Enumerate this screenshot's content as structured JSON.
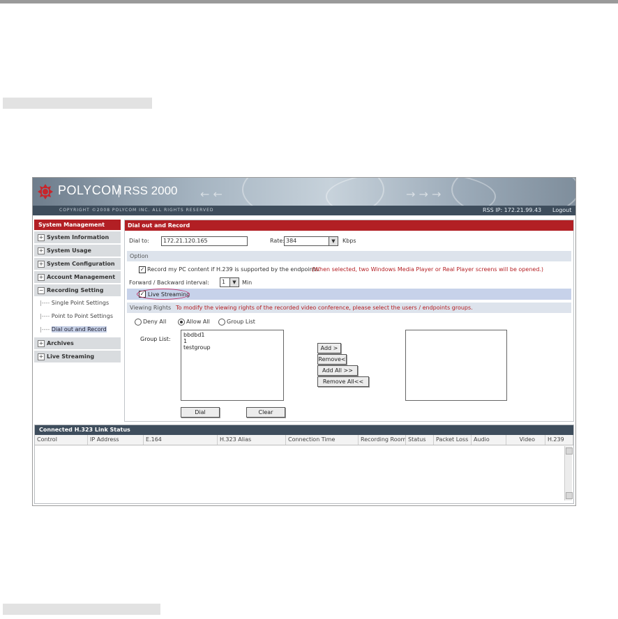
{
  "header": {
    "brand": "POLYCOM",
    "product": "RSS 2000",
    "copyright": "COPYRIGHT ©2008 POLYCOM INC. ALL RIGHTS RESERVED",
    "rss_ip": "RSS IP: 172.21.99.43",
    "logout": "Logout",
    "accent_color": "#b21f24",
    "logo_icon": "polycom-logo-icon"
  },
  "sidebar": {
    "title": "System Management",
    "items": [
      {
        "sign": "+",
        "label": "System Information"
      },
      {
        "sign": "+",
        "label": "System Usage"
      },
      {
        "sign": "+",
        "label": "System Configuration"
      },
      {
        "sign": "+",
        "label": "Account Management"
      },
      {
        "sign": "−",
        "label": "Recording Setting"
      }
    ],
    "subitems": [
      {
        "label": "Single Point Settings"
      },
      {
        "label": "Point to Point Settings"
      },
      {
        "label": "Dial out and Record"
      }
    ],
    "items_after": [
      {
        "sign": "+",
        "label": "Archives"
      },
      {
        "sign": "+",
        "label": "Live Streaming"
      }
    ]
  },
  "main": {
    "title": "Dial out and Record",
    "dial_to_label": "Dial to:",
    "dial_to_value": "172.21.120.165",
    "rate_label": "Rate:",
    "rate_value": "384",
    "rate_unit": "Kbps",
    "option_label": "Option",
    "record_pc_text": "Record my PC content if H.239 is supported by the endpoints.",
    "record_pc_note": "(When selected, two Windows Media Player or Real Player screens will be opened.)",
    "interval_label": "Forward / Backward interval:",
    "interval_value": "1",
    "interval_unit": "Min",
    "live_streaming_label": "Live Streaming",
    "viewing_rights_label": "Viewing Rights",
    "viewing_rights_note": "To modify the viewing rights of the recorded video conference, please select the users / endpoints groups.",
    "radio_deny": "Deny All",
    "radio_allow": "Allow All",
    "radio_group": "Group List",
    "group_list_label": "Group List:",
    "group_items": [
      "bbdbd1",
      "1",
      "testgroup"
    ],
    "btn_add": "Add >",
    "btn_remove": "Remove<",
    "btn_add_all": "Add All >>",
    "btn_remove_all": "Remove All<<",
    "btn_dial": "Dial",
    "btn_clear": "Clear"
  },
  "status": {
    "title": "Connected H.323 Link Status",
    "columns": [
      "Control",
      "IP Address",
      "E.164",
      "H.323 Alias",
      "Connection Time",
      "Recording Room",
      "Status",
      "Packet Loss",
      "Audio",
      "Video",
      "H.239"
    ]
  }
}
